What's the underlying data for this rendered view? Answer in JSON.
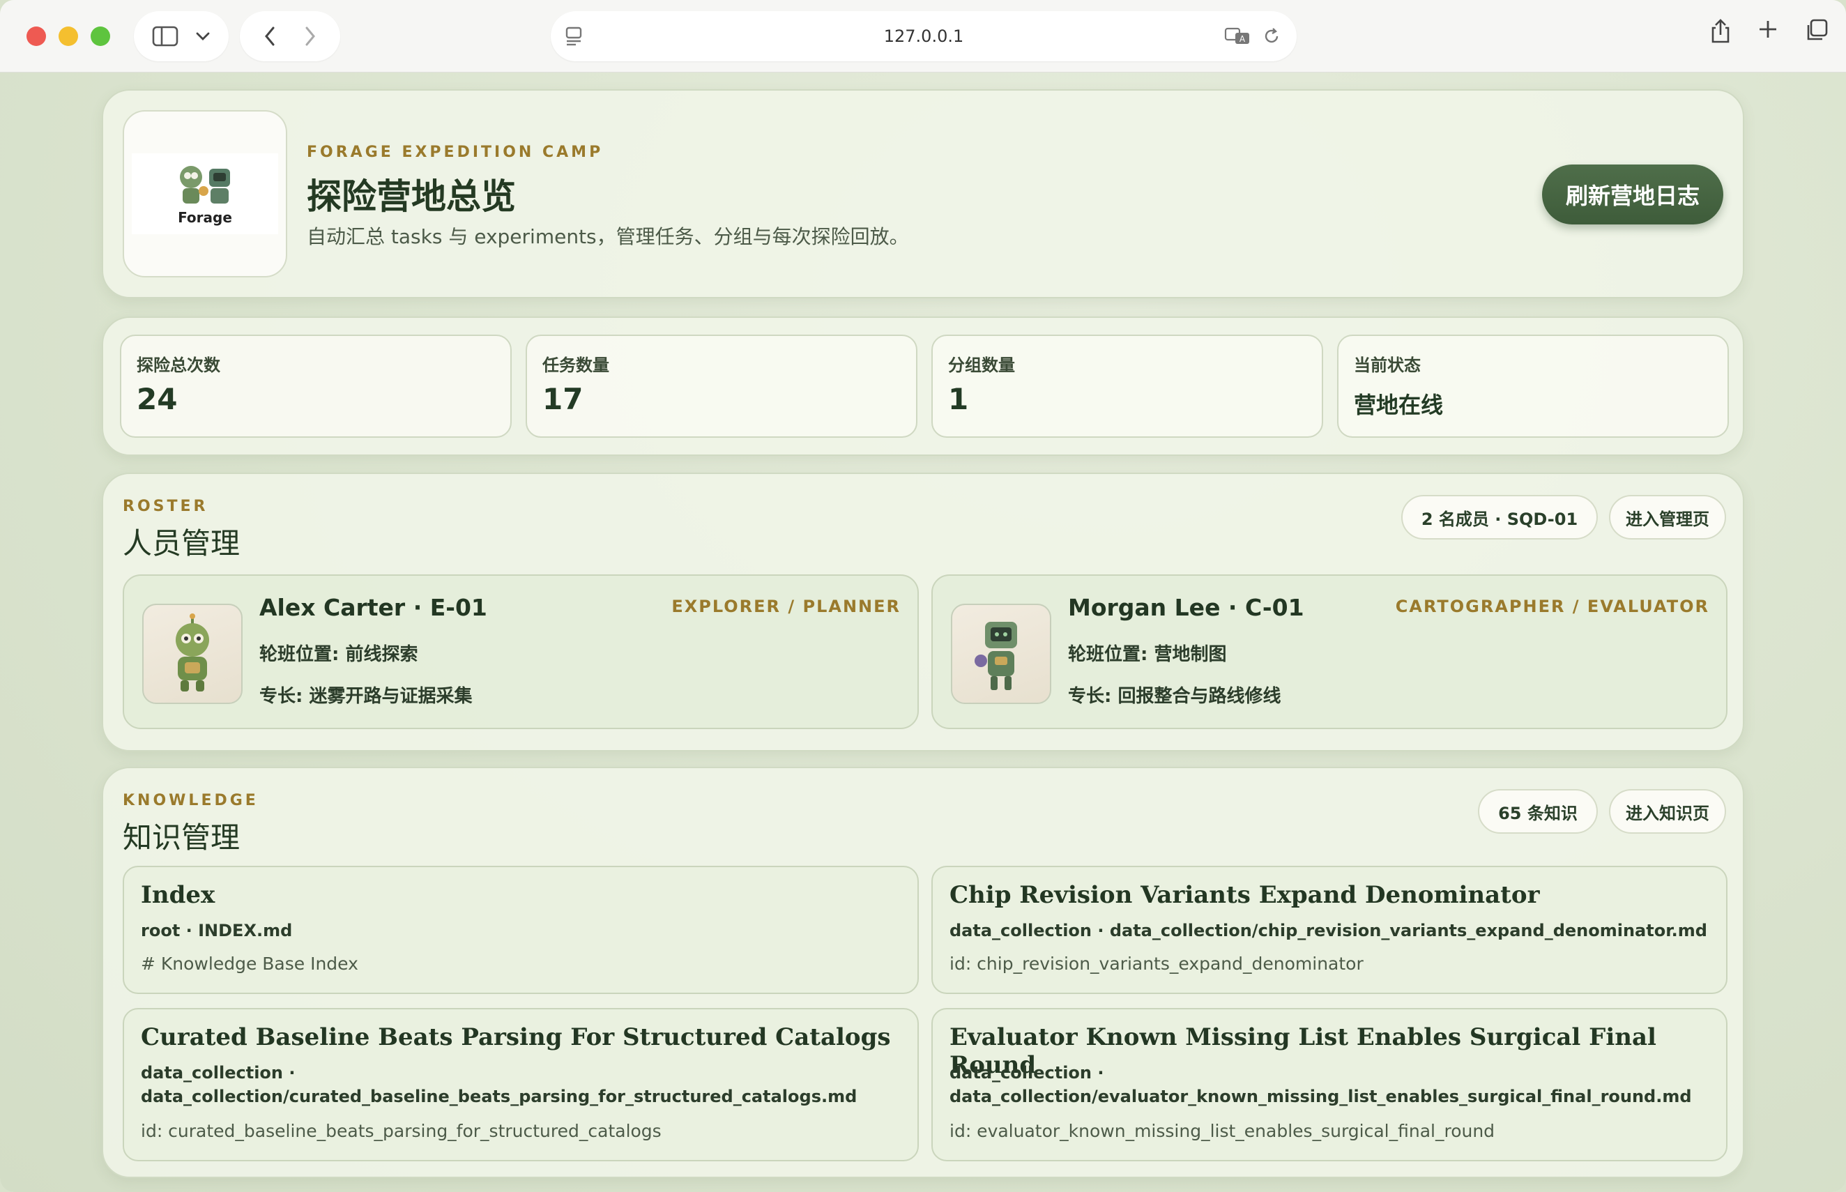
{
  "browser": {
    "url": "127.0.0.1"
  },
  "hero": {
    "kicker": "FORAGE EXPEDITION CAMP",
    "title": "探险营地总览",
    "subtitle": "自动汇总 tasks 与 experiments，管理任务、分组与每次探险回放。",
    "logo_text": "Forage",
    "refresh_label": "刷新营地日志"
  },
  "stats": [
    {
      "label": "探险总次数",
      "value": "24"
    },
    {
      "label": "任务数量",
      "value": "17"
    },
    {
      "label": "分组数量",
      "value": "1"
    },
    {
      "label": "当前状态",
      "value": "营地在线"
    }
  ],
  "roster": {
    "kicker": "ROSTER",
    "title": "人员管理",
    "badge": "2 名成员 · SQD-01",
    "enter_label": "进入管理页",
    "members": [
      {
        "name": "Alex Carter · E-01",
        "role": "EXPLORER / PLANNER",
        "shift": "轮班位置: 前线探索",
        "specialty": "专长: 迷雾开路与证据采集"
      },
      {
        "name": "Morgan Lee · C-01",
        "role": "CARTOGRAPHER / EVALUATOR",
        "shift": "轮班位置: 营地制图",
        "specialty": "专长: 回报整合与路线修线"
      }
    ]
  },
  "knowledge": {
    "kicker": "KNOWLEDGE",
    "title": "知识管理",
    "badge": "65 条知识",
    "enter_label": "进入知识页",
    "items": [
      {
        "title": "Index",
        "path": "root · INDEX.md",
        "detail": "# Knowledge Base Index"
      },
      {
        "title": "Chip Revision Variants Expand Denominator",
        "path": "data_collection · data_collection/chip_revision_variants_expand_denominator.md",
        "detail": "id: chip_revision_variants_expand_denominator"
      },
      {
        "title": "Curated Baseline Beats Parsing For Structured Catalogs",
        "path_group": "data_collection ·",
        "path": "data_collection/curated_baseline_beats_parsing_for_structured_catalogs.md",
        "detail": "id: curated_baseline_beats_parsing_for_structured_catalogs"
      },
      {
        "title": "Evaluator Known Missing List Enables Surgical Final Round",
        "path_group": "data_collection ·",
        "path": "data_collection/evaluator_known_missing_list_enables_surgical_final_round.md",
        "detail": "id: evaluator_known_missing_list_enables_surgical_final_round"
      }
    ]
  },
  "colors": {
    "accent_green": "#3e5c3a",
    "kicker_gold": "#9a7a2c",
    "panel_bg": "#f0f5e8"
  },
  "icons": [
    "sidebar-icon",
    "chevron-down-icon",
    "back-icon",
    "forward-icon",
    "page-icon",
    "translate-icon",
    "reload-icon",
    "share-icon",
    "new-tab-icon",
    "tabs-overview-icon"
  ]
}
